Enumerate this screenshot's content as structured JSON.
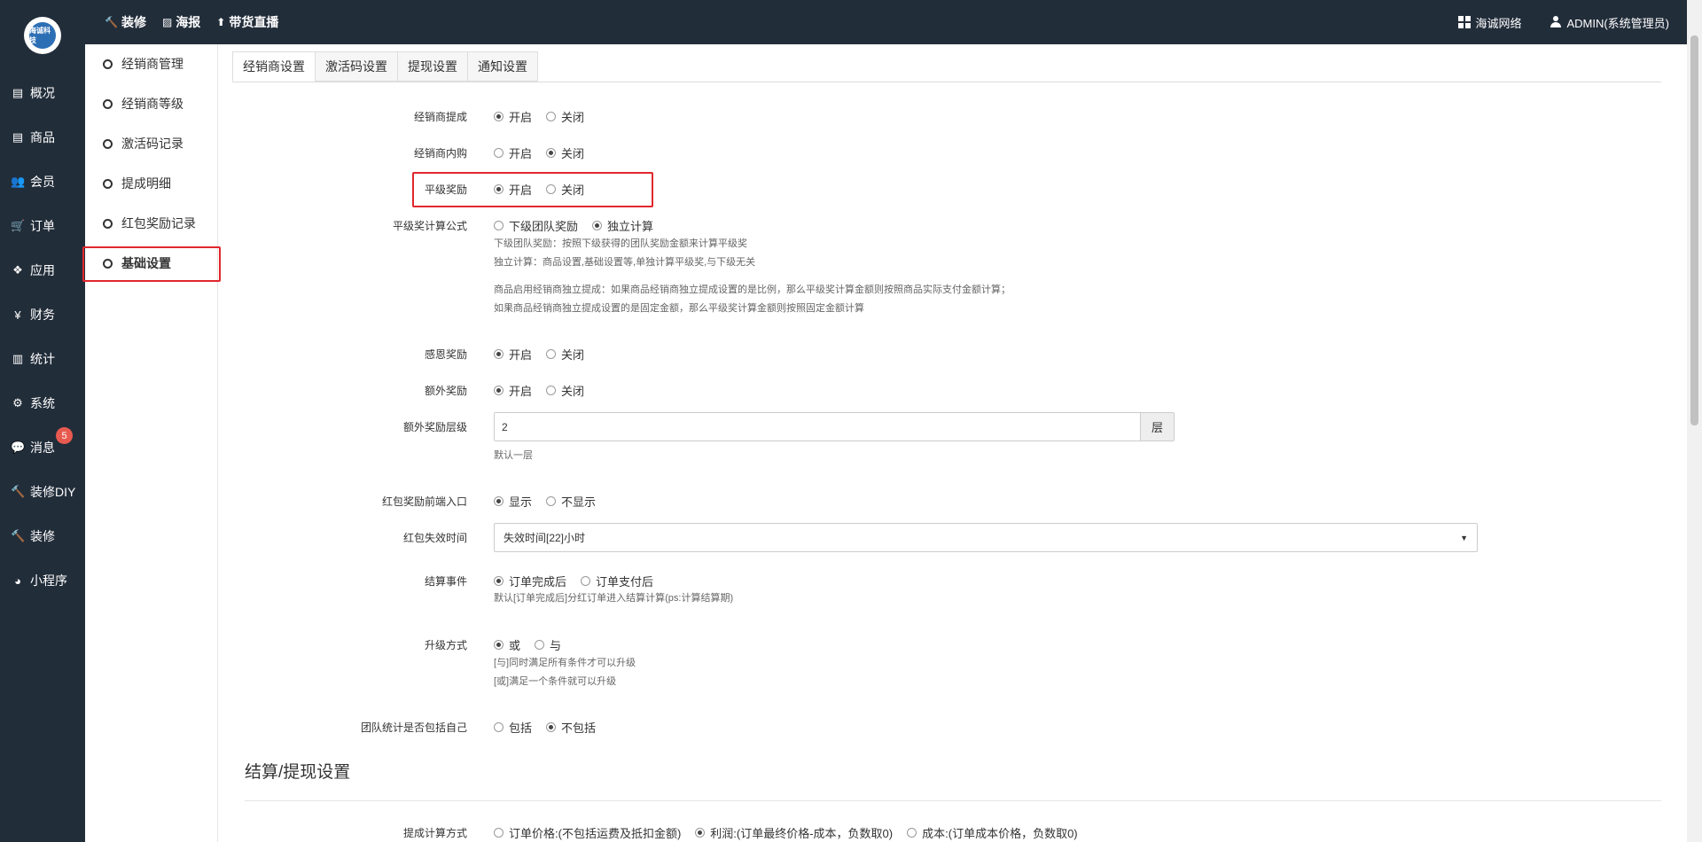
{
  "topbar": {
    "logo_text": "海诚科技",
    "nav": [
      {
        "icon": "hammer-icon",
        "glyph": "🔨",
        "label": "装修"
      },
      {
        "icon": "image-icon",
        "glyph": "▨",
        "label": "海报"
      },
      {
        "icon": "pin-icon",
        "glyph": "⬆",
        "label": "带货直播"
      }
    ],
    "brand_label": "海诚网络",
    "user_label": "ADMIN(系统管理员)"
  },
  "sidebar": {
    "items": [
      {
        "icon": "archive-icon",
        "glyph": "▤",
        "label": "概况"
      },
      {
        "icon": "archive-icon",
        "glyph": "▤",
        "label": "商品"
      },
      {
        "icon": "users-icon",
        "glyph": "👥",
        "label": "会员"
      },
      {
        "icon": "cart-icon",
        "glyph": "🛒",
        "label": "订单"
      },
      {
        "icon": "cubes-icon",
        "glyph": "❖",
        "label": "应用"
      },
      {
        "icon": "yen-icon",
        "glyph": "¥",
        "label": "财务"
      },
      {
        "icon": "chart-icon",
        "glyph": "▥",
        "label": "统计"
      },
      {
        "icon": "gears-icon",
        "glyph": "⚙",
        "label": "系统"
      },
      {
        "icon": "chat-icon",
        "glyph": "💬",
        "label": "消息",
        "badge": "5"
      },
      {
        "icon": "hammer-icon",
        "glyph": "🔨",
        "label": "装修DIY"
      },
      {
        "icon": "hammer-icon",
        "glyph": "🔨",
        "label": "装修"
      },
      {
        "icon": "wechat-icon",
        "glyph": "◕",
        "label": "小程序"
      }
    ]
  },
  "subside": {
    "items": [
      "经销商管理",
      "经销商等级",
      "激活码记录",
      "提成明细",
      "红包奖励记录",
      "基础设置"
    ]
  },
  "tabs": [
    "经销商设置",
    "激活码设置",
    "提现设置",
    "通知设置"
  ],
  "form": {
    "commission": {
      "label": "经销商提成",
      "opt1": "开启",
      "opt2": "关闭"
    },
    "inner_buy": {
      "label": "经销商内购",
      "opt1": "开启",
      "opt2": "关闭"
    },
    "peer_reward": {
      "label": "平级奖励",
      "opt1": "开启",
      "opt2": "关闭"
    },
    "peer_formula": {
      "label": "平级奖计算公式",
      "opt1": "下级团队奖励",
      "opt2": "独立计算",
      "help1": "下级团队奖励：按照下级获得的团队奖励金额来计算平级奖",
      "help2": "独立计算：商品设置,基础设置等,单独计算平级奖,与下级无关",
      "help3": "商品启用经销商独立提成：如果商品经销商独立提成设置的是比例，那么平级奖计算金额则按照商品实际支付金额计算；",
      "help4": "如果商品经销商独立提成设置的是固定金额，那么平级奖计算金额则按照固定金额计算"
    },
    "gratitude": {
      "label": "感恩奖励",
      "opt1": "开启",
      "opt2": "关闭"
    },
    "extra": {
      "label": "额外奖励",
      "opt1": "开启",
      "opt2": "关闭"
    },
    "extra_level": {
      "label": "额外奖励层级",
      "value": "2",
      "addon": "层",
      "help": "默认一层"
    },
    "redpack_entry": {
      "label": "红包奖励前端入口",
      "opt1": "显示",
      "opt2": "不显示"
    },
    "redpack_expire": {
      "label": "红包失效时间",
      "value": "失效时间[22]小时"
    },
    "settle_event": {
      "label": "结算事件",
      "opt1": "订单完成后",
      "opt2": "订单支付后",
      "help": "默认[订单完成后]分红订单进入结算计算(ps:计算结算期)"
    },
    "upgrade": {
      "label": "升级方式",
      "opt1": "或",
      "opt2": "与",
      "help1": "[与]同时满足所有条件才可以升级",
      "help2": "[或]满足一个条件就可以升级"
    },
    "team_self": {
      "label": "团队统计是否包括自己",
      "opt1": "包括",
      "opt2": "不包括"
    }
  },
  "section": {
    "title": "结算/提现设置",
    "calc": {
      "label": "提成计算方式",
      "opt1": "订单价格:(不包括运费及抵扣金额)",
      "opt2": "利润:(订单最终价格-成本，负数取0)",
      "opt3": "成本:(订单成本价格，负数取0)"
    }
  }
}
